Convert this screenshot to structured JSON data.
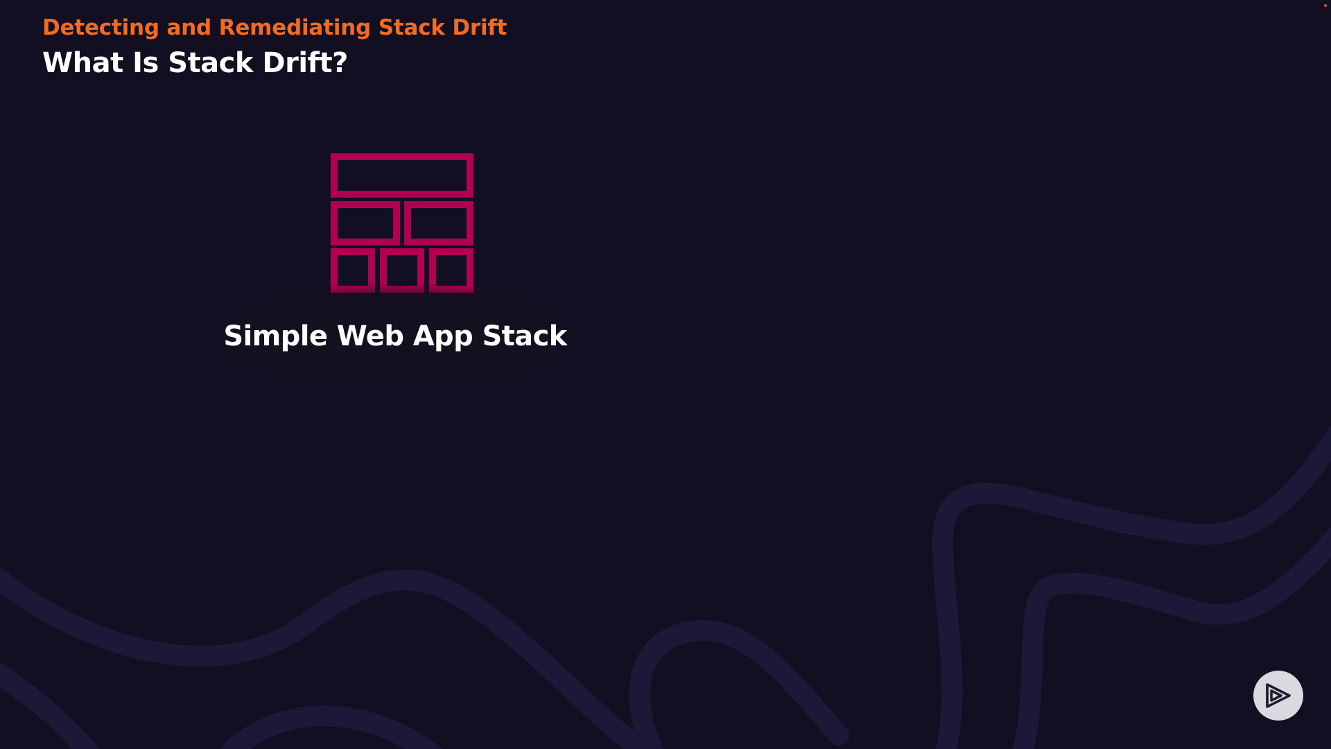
{
  "header": {
    "course_title": "Detecting and Remediating Stack Drift",
    "slide_title": "What Is Stack Drift?"
  },
  "diagram": {
    "stack_icon": "brick-stack-icon",
    "stack_label": "Simple Web App Stack"
  },
  "player": {
    "logo_icon": "play-logo-icon"
  },
  "colors": {
    "background": "#130f22",
    "accent_orange": "#f26b21",
    "icon_magenta": "#b0004f",
    "wave": "#1c1838",
    "logo_bg": "#d9d9df"
  }
}
